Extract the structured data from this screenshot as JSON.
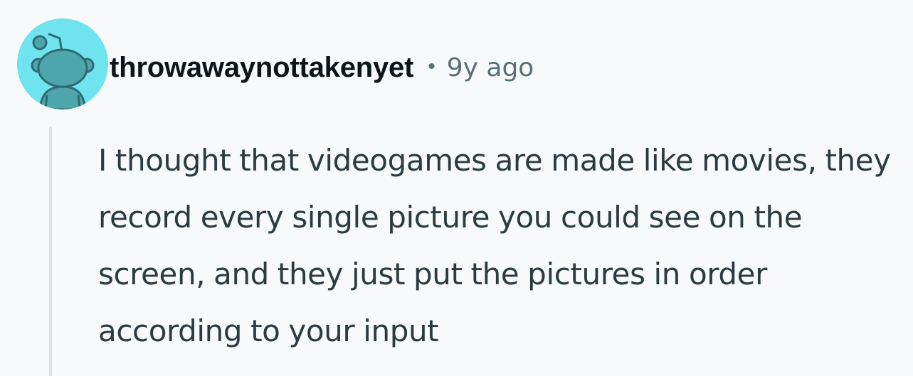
{
  "comment": {
    "author": "throwawaynottakenyet",
    "separator": "•",
    "timestamp": "9y ago",
    "body": "I thought that videogames are made like movies, they record every single picture you could see on the screen, and they just put the pictures in order according to your input"
  },
  "avatar": {
    "icon": "snoo-avatar-icon",
    "background_color": "#6fe3ee",
    "figure_color": "#4ea6ad"
  },
  "colors": {
    "page_background": "#f7f9fb",
    "username": "#0c1519",
    "meta_text": "#576f76",
    "body_text": "#2a3c42",
    "thread_line": "#dbe3e6"
  }
}
